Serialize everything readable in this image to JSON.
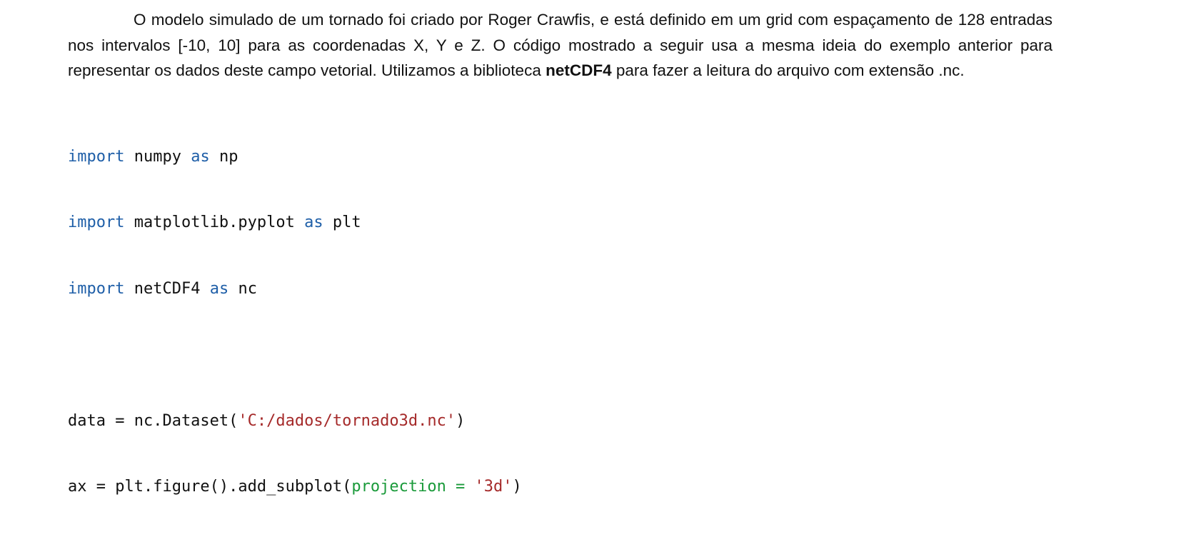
{
  "paragraph": {
    "text_before_bold": "O modelo simulado de um tornado foi criado por Roger Crawfis, e está definido em um grid com espaçamento de 128 entradas nos intervalos [-10, 10] para as coordenadas X, Y e Z. O código mostrado a seguir usa a mesma ideia do exemplo anterior para representar os dados deste campo vetorial. Utilizamos a biblioteca ",
    "bold": "netCDF4",
    "text_after_bold": " para fazer a leitura do arquivo com extensão .nc."
  },
  "code": {
    "line1": {
      "kw1": "import",
      "t1": " numpy ",
      "kw2": "as",
      "t2": " np"
    },
    "line2": {
      "kw1": "import",
      "t1": " matplotlib.pyplot ",
      "kw2": "as",
      "t2": " plt"
    },
    "line3": {
      "kw1": "import",
      "t1": " netCDF4 ",
      "kw2": "as",
      "t2": " nc"
    },
    "line5": {
      "t1": "data = nc.Dataset(",
      "str": "'C:/dados/tornado3d.nc'",
      "t2": ")"
    },
    "line6": {
      "t1": "ax = plt.figure().add_subplot(",
      "kwarg": "projection = ",
      "str": "'3d'",
      "t2": ")"
    }
  },
  "colors": {
    "keyword": "#1f5fa8",
    "string": "#a52a2a",
    "kwarg": "#1a9a3a"
  }
}
